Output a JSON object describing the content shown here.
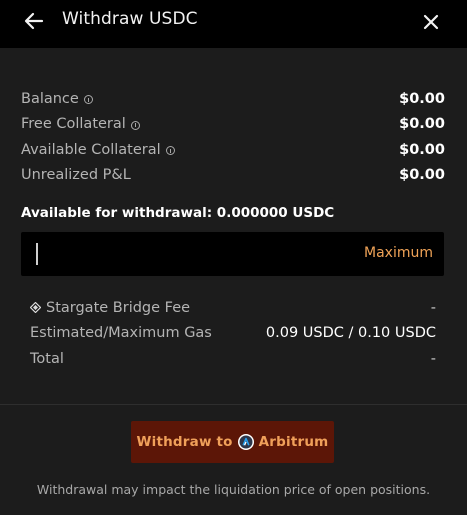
{
  "header": {
    "title": "Withdraw USDC",
    "back_icon": "arrow-left-icon",
    "close_icon": "close-icon"
  },
  "summary": [
    {
      "label": "Balance",
      "value": "$0.00",
      "has_info": true
    },
    {
      "label": "Free Collateral",
      "value": "$0.00",
      "has_info": true
    },
    {
      "label": "Available Collateral",
      "value": "$0.00",
      "has_info": true
    },
    {
      "label": "Unrealized P&L",
      "value": "$0.00",
      "has_info": false
    }
  ],
  "available": "Available for withdrawal: 0.000000 USDC",
  "amount": {
    "value": "",
    "max_label": "Maximum"
  },
  "fees": [
    {
      "label": "Stargate Bridge Fee",
      "value": "-",
      "icon": "stargate-icon"
    },
    {
      "label": "Estimated/Maximum Gas",
      "value": "0.09 USDC / 0.10 USDC"
    },
    {
      "label": "Total",
      "value": "-"
    }
  ],
  "action": {
    "prefix": "Withdraw to",
    "chain": "Arbitrum",
    "chain_icon": "arbitrum-icon"
  },
  "note": "Withdrawal may impact the liquidation price of open positions.",
  "colors": {
    "accent": "#f0a357",
    "button_bg": "#5c1607",
    "panel_bg": "#1c1c1c",
    "header_bg": "#000000"
  }
}
